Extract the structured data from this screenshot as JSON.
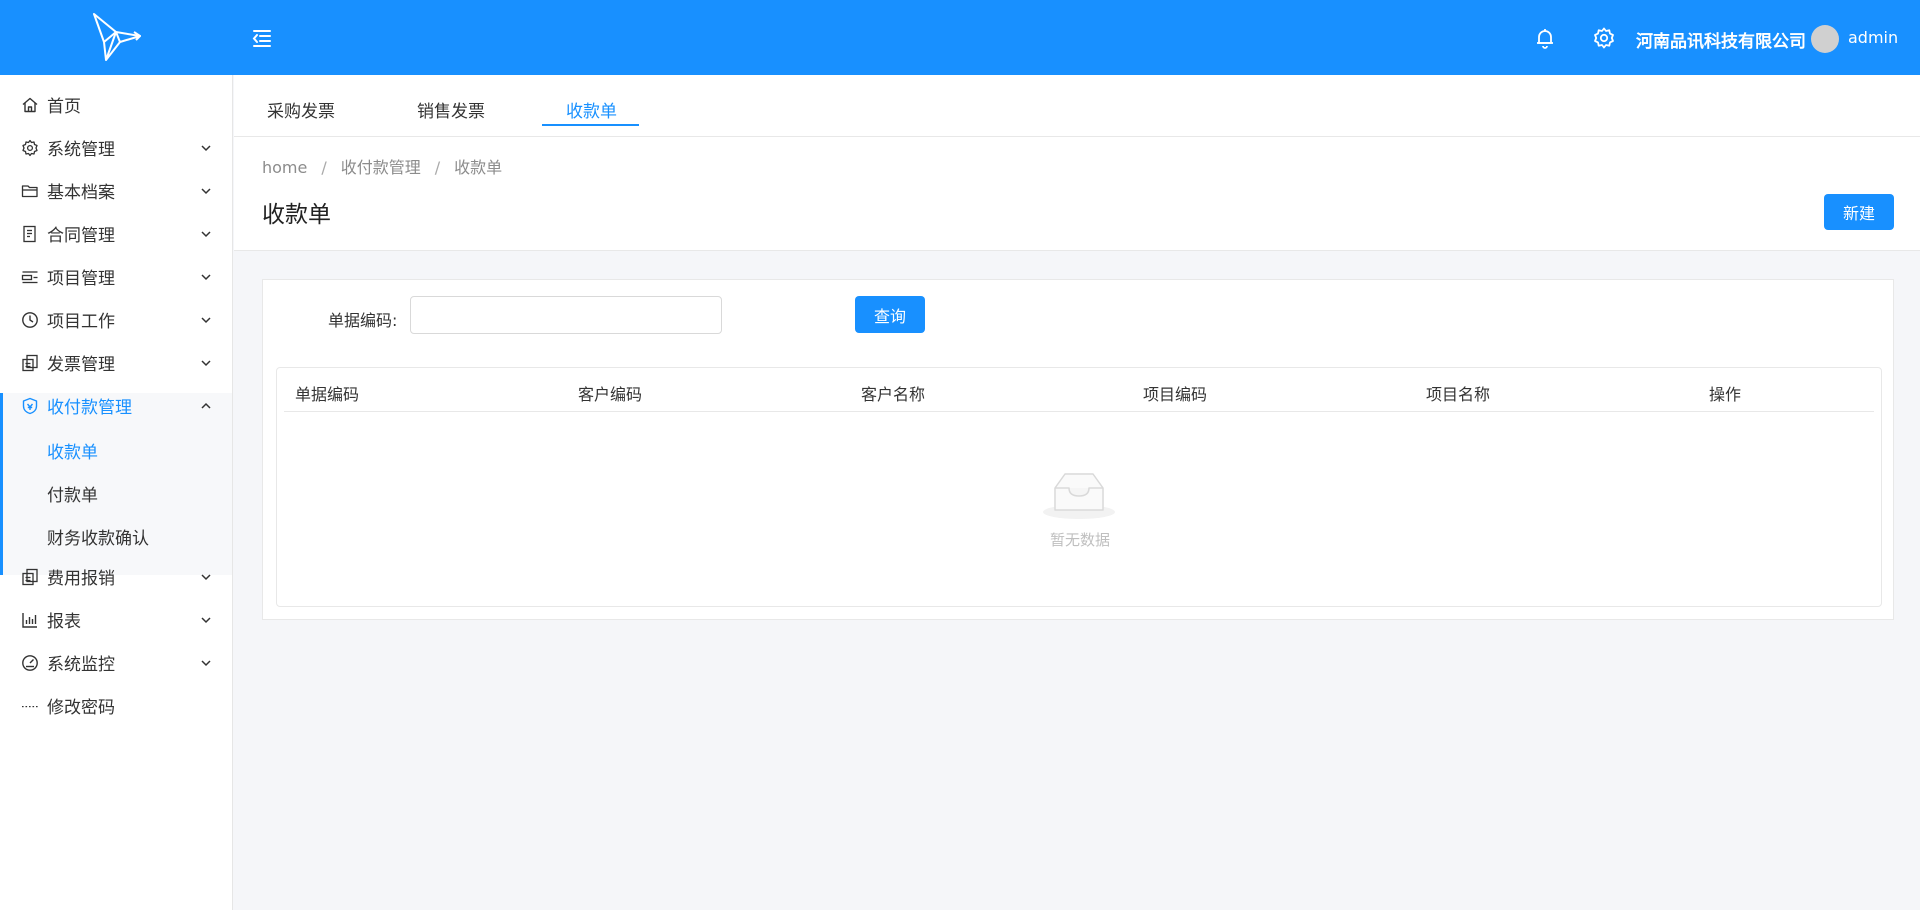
{
  "header": {
    "company": "河南品讯科技有限公司",
    "username": "admin",
    "colors": {
      "primary": "#1890ff"
    },
    "icons": [
      "logo-icon",
      "menu-fold-icon",
      "bell-icon",
      "gear-icon",
      "avatar"
    ]
  },
  "sidebar": {
    "items": [
      {
        "label": "首页",
        "icon": "home-icon"
      },
      {
        "label": "系统管理",
        "icon": "gear-icon"
      },
      {
        "label": "基本档案",
        "icon": "folder-icon"
      },
      {
        "label": "合同管理",
        "icon": "contract-icon"
      },
      {
        "label": "项目管理",
        "icon": "project-icon"
      },
      {
        "label": "项目工作",
        "icon": "clock-icon"
      },
      {
        "label": "发票管理",
        "icon": "invoice-icon"
      },
      {
        "label": "收付款管理",
        "icon": "shield-icon"
      },
      {
        "label": "费用报销",
        "icon": "expense-icon"
      },
      {
        "label": "报表",
        "icon": "bar-chart-icon"
      },
      {
        "label": "系统监控",
        "icon": "dashboard-icon"
      },
      {
        "label": "修改密码",
        "icon": "dots-icon"
      }
    ],
    "submenu": [
      {
        "label": "收款单"
      },
      {
        "label": "付款单"
      },
      {
        "label": "财务收款确认"
      }
    ]
  },
  "tabs": [
    {
      "label": "采购发票"
    },
    {
      "label": "销售发票"
    },
    {
      "label": "收款单"
    }
  ],
  "breadcrumb": [
    "home",
    "收付款管理",
    "收款单"
  ],
  "breadcrumb_sep": "/",
  "page": {
    "title": "收款单",
    "new_button": "新建"
  },
  "search": {
    "label": "单据编码:",
    "value": "",
    "placeholder": "",
    "query_button": "查询"
  },
  "table": {
    "columns": [
      "单据编码",
      "客户编码",
      "客户名称",
      "项目编码",
      "项目名称",
      "操作"
    ],
    "rows": [],
    "empty_text": "暂无数据"
  }
}
